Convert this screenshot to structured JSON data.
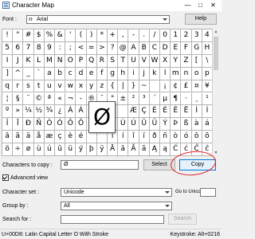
{
  "window": {
    "title": "Character Map",
    "minimize_icon": "minimize-icon",
    "maximize_icon": "maximize-icon",
    "close_icon": "close-icon"
  },
  "font": {
    "label": "Font :",
    "value": "Arial",
    "type_icon": "truetype-icon",
    "help_button": "Help"
  },
  "grid": {
    "rows": [
      [
        "!",
        "\"",
        "#",
        "$",
        "%",
        "&",
        "'",
        "(",
        ")",
        "*",
        "+",
        ",",
        "-",
        ".",
        "/",
        "0",
        "1",
        "2",
        "3",
        "4"
      ],
      [
        "5",
        "6",
        "7",
        "8",
        "9",
        ":",
        ";",
        "<",
        "=",
        ">",
        "?",
        "@",
        "A",
        "B",
        "C",
        "D",
        "E",
        "F",
        "G",
        "H"
      ],
      [
        "I",
        "J",
        "K",
        "L",
        "M",
        "N",
        "O",
        "P",
        "Q",
        "R",
        "S",
        "T",
        "U",
        "V",
        "W",
        "X",
        "Y",
        "Z",
        "[",
        "\\"
      ],
      [
        "]",
        "^",
        "_",
        "`",
        "a",
        "b",
        "c",
        "d",
        "e",
        "f",
        "g",
        "h",
        "i",
        "j",
        "k",
        "l",
        "m",
        "n",
        "o",
        "p"
      ],
      [
        "q",
        "r",
        "s",
        "t",
        "u",
        "v",
        "w",
        "x",
        "y",
        "z",
        "{",
        "|",
        "}",
        "~",
        "",
        "¡",
        "¢",
        "£",
        "¤",
        "¥"
      ],
      [
        "¦",
        "§",
        "¨",
        "©",
        "ª",
        "«",
        "¬",
        "-",
        "®",
        "¯",
        "°",
        "±",
        "²",
        "³",
        "´",
        "µ",
        "¶",
        "·",
        "¸",
        "¹"
      ],
      [
        "º",
        "»",
        "¼",
        "½",
        "¾",
        "¿",
        "À",
        "Á",
        "Â",
        "Ã",
        "",
        "",
        "Æ",
        "Ç",
        "È",
        "É",
        "Ê",
        "Ë",
        "Ì",
        "Í"
      ],
      [
        "Î",
        "Ï",
        "Ð",
        "Ñ",
        "Ò",
        "Ó",
        "Ô",
        "Õ",
        "Ö",
        "",
        "",
        "Ù",
        "Ú",
        "Û",
        "Ü",
        "Ý",
        "Þ",
        "ß",
        "à",
        "á"
      ],
      [
        "â",
        "ã",
        "ä",
        "å",
        "æ",
        "ç",
        "è",
        "é",
        "",
        "",
        "ì",
        "í",
        "î",
        "ï",
        "ð",
        "ñ",
        "ò",
        "ó",
        "ô",
        "õ"
      ],
      [
        "ö",
        "÷",
        "ø",
        "ù",
        "ú",
        "û",
        "ü",
        "ý",
        "þ",
        "ÿ",
        "Ā",
        "ā",
        "Ă",
        "ă",
        "Ą",
        "ą",
        "Ć",
        "ć",
        "Ĉ",
        "ĉ"
      ]
    ],
    "magnified_char": "Ø",
    "scroll_up_icon": "scroll-up-arrow-icon",
    "scroll_down_icon": "scroll-down-arrow-icon"
  },
  "copy": {
    "label": "Characters to copy :",
    "value": "Ø",
    "select_button": "Select",
    "copy_button": "Copy",
    "annotation_color": "#e02020"
  },
  "advanced": {
    "checkbox_label": "Advanced view",
    "checked": true
  },
  "charset": {
    "label": "Character set :",
    "value": "Unicode",
    "goto_label": "Go to Unicode :"
  },
  "groupby": {
    "label": "Group by :",
    "value": "All"
  },
  "search": {
    "label": "Search for :",
    "value": "",
    "button": "Search"
  },
  "status": {
    "left": "U+00D8: Latin Capital Letter O With Stroke",
    "right": "Keystroke: Alt+0216"
  }
}
